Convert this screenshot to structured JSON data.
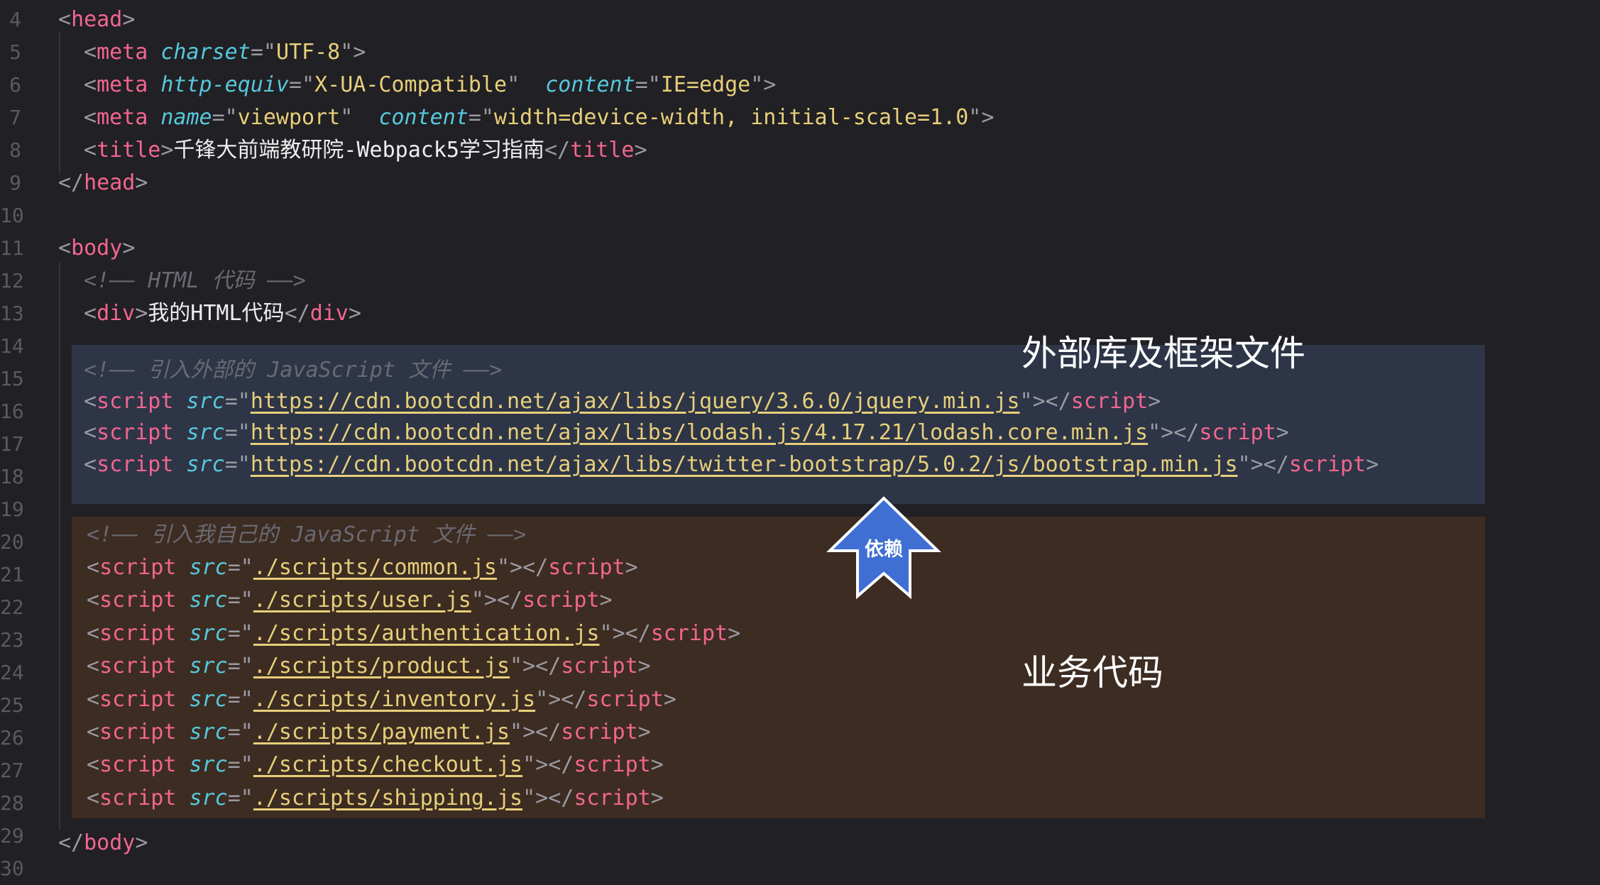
{
  "line_numbers": [
    "4",
    "5",
    "6",
    "7",
    "8",
    "9",
    "10",
    "11",
    "12",
    "13",
    "14",
    "15",
    "16",
    "17",
    "18",
    "19",
    "20",
    "21",
    "22",
    "23",
    "24",
    "25",
    "26",
    "27",
    "28",
    "29",
    "30"
  ],
  "code": {
    "l4": {
      "tag": "head"
    },
    "l5": {
      "tag": "meta",
      "attr1": "charset",
      "val1": "UTF-8"
    },
    "l6": {
      "tag": "meta",
      "attr1": "http-equiv",
      "val1": "X-UA-Compatible",
      "attr2": "content",
      "val2": "IE=edge"
    },
    "l7": {
      "tag": "meta",
      "attr1": "name",
      "val1": "viewport",
      "attr2": "content",
      "val2": "width=device-width, initial-scale=1.0"
    },
    "l8": {
      "tag": "title",
      "text": "千锋大前端教研院-Webpack5学习指南"
    },
    "l9": {
      "tag": "head"
    },
    "l11": {
      "tag": "body"
    },
    "l12": {
      "comment": "<!—— HTML 代码 ——>"
    },
    "l13": {
      "tag": "div",
      "text": "我的HTML代码"
    },
    "l14": {
      "comment": "<!—— 引入外部的 JavaScript 文件 ——>"
    },
    "l15": {
      "tag": "script",
      "attr": "src",
      "src": "https://cdn.bootcdn.net/ajax/libs/jquery/3.6.0/jquery.min.js"
    },
    "l16": {
      "tag": "script",
      "attr": "src",
      "src": "https://cdn.bootcdn.net/ajax/libs/lodash.js/4.17.21/lodash.core.min.js"
    },
    "l17": {
      "tag": "script",
      "attr": "src",
      "src": "https://cdn.bootcdn.net/ajax/libs/twitter-bootstrap/5.0.2/js/bootstrap.min.js"
    },
    "l19": {
      "comment": "<!—— 引入我自己的 JavaScript 文件 ——>"
    },
    "l20": {
      "tag": "script",
      "attr": "src",
      "src": "./scripts/common.js"
    },
    "l21": {
      "tag": "script",
      "attr": "src",
      "src": "./scripts/user.js"
    },
    "l22": {
      "tag": "script",
      "attr": "src",
      "src": "./scripts/authentication.js"
    },
    "l23": {
      "tag": "script",
      "attr": "src",
      "src": "./scripts/product.js"
    },
    "l24": {
      "tag": "script",
      "attr": "src",
      "src": "./scripts/inventory.js"
    },
    "l25": {
      "tag": "script",
      "attr": "src",
      "src": "./scripts/payment.js"
    },
    "l26": {
      "tag": "script",
      "attr": "src",
      "src": "./scripts/checkout.js"
    },
    "l27": {
      "tag": "script",
      "attr": "src",
      "src": "./scripts/shipping.js"
    },
    "l28": {
      "tag": "body"
    }
  },
  "annotations": {
    "external_label": "外部库及框架文件",
    "business_label": "业务代码",
    "arrow_label": "依赖"
  },
  "colors": {
    "editor_bg": "#212024",
    "external_band": "#2d3547",
    "business_band": "#3d2c22",
    "arrow_fill": "#3f6fd3",
    "tag": "#f2668f",
    "attribute": "#56c8dc",
    "string": "#e7cf7a",
    "comment": "#6a6a72"
  }
}
